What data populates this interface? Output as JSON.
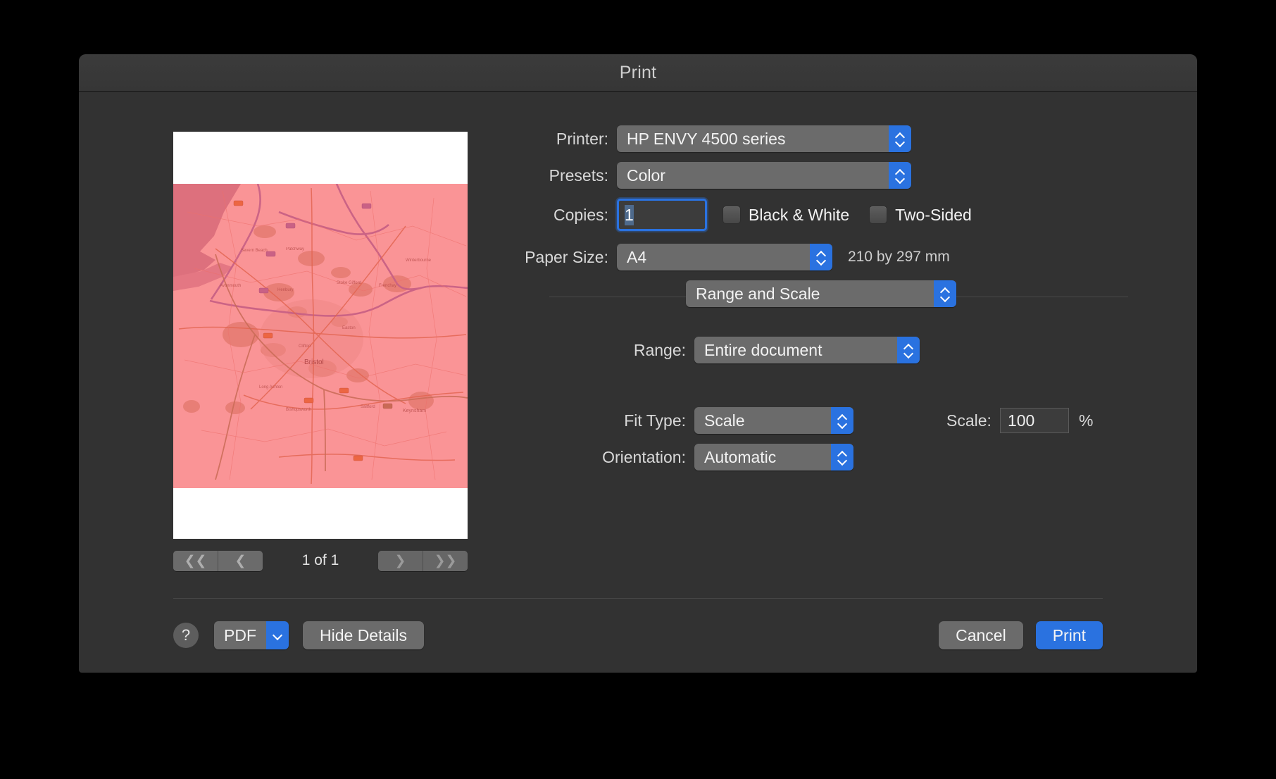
{
  "window": {
    "title": "Print"
  },
  "preview": {
    "map_label_main": "Bristol",
    "map_tint_color": "#ff404a",
    "nav": {
      "first_icon": "double-chevron-left-icon",
      "prev_icon": "chevron-left-icon",
      "next_icon": "chevron-right-icon",
      "last_icon": "double-chevron-right-icon",
      "page_indicator": "1 of 1"
    }
  },
  "controls": {
    "printer": {
      "label": "Printer:",
      "value": "HP ENVY 4500 series"
    },
    "presets": {
      "label": "Presets:",
      "value": "Color"
    },
    "copies": {
      "label": "Copies:",
      "value": "1"
    },
    "black_and_white": {
      "label": "Black & White",
      "checked": false
    },
    "two_sided": {
      "label": "Two-Sided",
      "checked": false
    },
    "paper_size": {
      "label": "Paper Size:",
      "value": "A4",
      "note": "210 by 297 mm"
    },
    "pane": {
      "value": "Range and Scale"
    },
    "range": {
      "label": "Range:",
      "value": "Entire document"
    },
    "fit_type": {
      "label": "Fit Type:",
      "value": "Scale"
    },
    "orientation": {
      "label": "Orientation:",
      "value": "Automatic"
    },
    "scale": {
      "label": "Scale:",
      "value": "100",
      "unit": "%"
    }
  },
  "footer": {
    "help_label": "?",
    "pdf_label": "PDF",
    "hide_details_label": "Hide Details",
    "cancel_label": "Cancel",
    "print_label": "Print"
  },
  "colors": {
    "accent": "#2a72e0",
    "dialog_bg": "#323232",
    "control_bg": "#6b6b6b"
  }
}
